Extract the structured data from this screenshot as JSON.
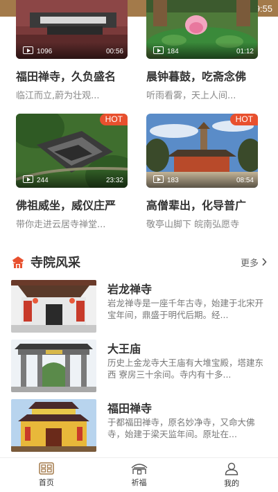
{
  "status_bar": {
    "time": "9:55",
    "background": "#a37a4a"
  },
  "videos": [
    {
      "title": "福田禅寺，久负盛名",
      "subtitle": "临江而立,蔚为壮观...",
      "views": "1096",
      "duration": "00:56",
      "hot": ""
    },
    {
      "title": "晨钟暮鼓，吃斋念佛",
      "subtitle": "听雨看雾，天上人间...",
      "views": "184",
      "duration": "01:12",
      "hot": ""
    },
    {
      "title": "佛祖威坐，威仪庄严",
      "subtitle": "带你走进云居寺禅堂...",
      "views": "244",
      "duration": "23:32",
      "hot": "HOT"
    },
    {
      "title": "高僧辈出，化导普广",
      "subtitle": "敬亭山脚下 皖南弘愿寺",
      "views": "183",
      "duration": "08:54",
      "hot": "HOT"
    }
  ],
  "section": {
    "title": "寺院风采",
    "more": "更多",
    "icon": "temple-icon",
    "accent": "#e8502e"
  },
  "temples": [
    {
      "name": "岩龙禅寺",
      "desc": "岩龙禅寺是一座千年古寺，始建于北宋开宝年间，鼎盛于明代后期。经..."
    },
    {
      "name": "大王庙",
      "desc": "历史上金龙寺大王庙有大堆宝殿，塔建东西 寮房三十余间。寺内有十多..."
    },
    {
      "name": "福田禅寺",
      "desc": "于都福田禅寺，原名妙净寺，又命大佛寺，始建于梁天监年间。原址在..."
    }
  ],
  "nav": [
    {
      "label": "首页",
      "icon": "home-icon"
    },
    {
      "label": "祈福",
      "icon": "temple-roof-icon"
    },
    {
      "label": "我的",
      "icon": "user-icon"
    }
  ]
}
